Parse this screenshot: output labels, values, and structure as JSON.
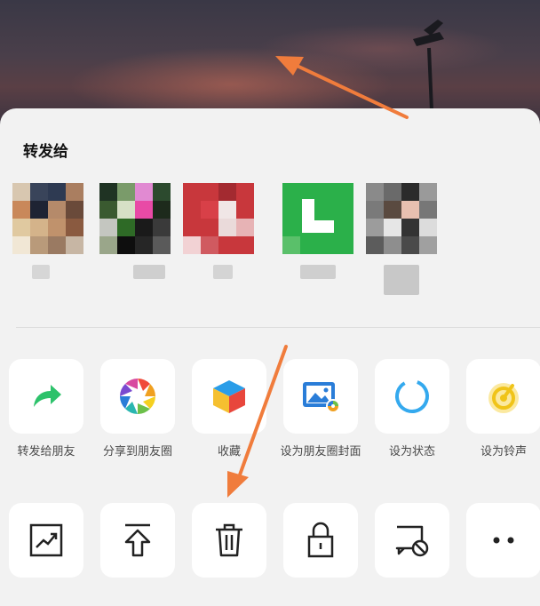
{
  "share_sheet": {
    "title": "转发给",
    "recipients": [
      {
        "name": "contact-1"
      },
      {
        "name": "contact-2"
      },
      {
        "name": "contact-3"
      },
      {
        "name": "contact-4"
      },
      {
        "name": "contact-5"
      }
    ],
    "actions_row1": [
      {
        "label": "转发给朋友",
        "icon": "forward-arrow-icon",
        "color": "#2dc26b"
      },
      {
        "label": "分享到朋友圈",
        "icon": "moments-shutter-icon",
        "color": "#f0a020"
      },
      {
        "label": "收藏",
        "icon": "favorites-cube-icon",
        "color": "#f5c030"
      },
      {
        "label": "设为朋友圈封面",
        "icon": "set-cover-image-icon",
        "color": "#2a7dd8"
      },
      {
        "label": "设为状态",
        "icon": "status-ring-icon",
        "color": "#34a9ee"
      },
      {
        "label": "设为铃声",
        "icon": "ringtone-icon",
        "color": "#f0c419"
      }
    ],
    "actions_row2": [
      {
        "icon": "trend-chart-icon"
      },
      {
        "icon": "upload-top-icon"
      },
      {
        "icon": "trash-icon"
      },
      {
        "icon": "lock-icon"
      },
      {
        "icon": "block-message-icon"
      },
      {
        "icon": "more-dots-icon"
      }
    ]
  },
  "annotations": {
    "arrow_color": "#f07c3c"
  }
}
